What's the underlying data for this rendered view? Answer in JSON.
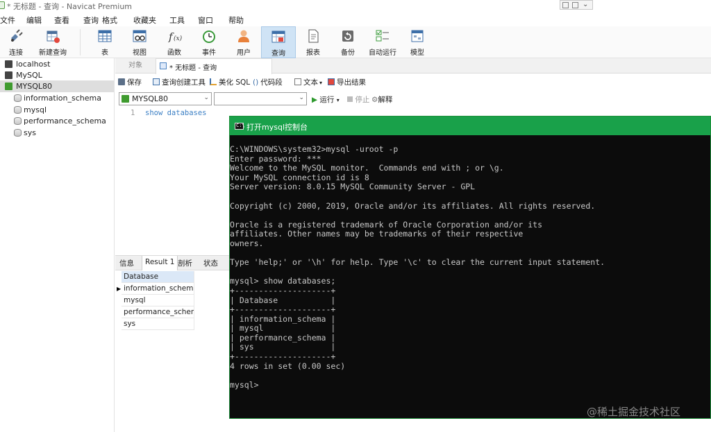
{
  "window": {
    "title": "* 无标题 - 查询 - Navicat Premium"
  },
  "menu": [
    "文件",
    "编辑",
    "查看",
    "查询",
    "格式",
    "收藏夹",
    "工具",
    "窗口",
    "帮助"
  ],
  "toolbar": {
    "buttons": [
      {
        "label": "连接",
        "icon": "plug-icon"
      },
      {
        "label": "新建查询",
        "icon": "new-query-icon"
      },
      {
        "label": "表",
        "icon": "table-icon"
      },
      {
        "label": "视图",
        "icon": "view-icon"
      },
      {
        "label": "函数",
        "icon": "function-icon"
      },
      {
        "label": "事件",
        "icon": "event-clock-icon"
      },
      {
        "label": "用户",
        "icon": "user-icon"
      },
      {
        "label": "查询",
        "icon": "query-icon",
        "active": true
      },
      {
        "label": "报表",
        "icon": "report-icon"
      },
      {
        "label": "备份",
        "icon": "backup-icon"
      },
      {
        "label": "自动运行",
        "icon": "auto-run-icon"
      },
      {
        "label": "模型",
        "icon": "model-icon"
      }
    ]
  },
  "tree": {
    "items": [
      {
        "label": "localhost"
      },
      {
        "label": "MySQL"
      },
      {
        "label": "MYSQL80",
        "selected": true
      },
      {
        "label": "information_schema"
      },
      {
        "label": "mysql"
      },
      {
        "label": "performance_schema"
      },
      {
        "label": "sys"
      }
    ]
  },
  "tabs": {
    "objects": "对象",
    "query": "* 无标题 - 查询"
  },
  "query_tools": {
    "save": "保存",
    "builder": "查询创建工具",
    "beautify": "美化 SQL",
    "snippet": "代码段",
    "text": "文本",
    "export": "导出结果"
  },
  "selectors": {
    "connection": "MYSQL80",
    "database": "",
    "run": "运行",
    "stop": "停止",
    "explain": "解释"
  },
  "editor": {
    "line_number": "1",
    "code": "show databases"
  },
  "result": {
    "tabs": [
      "信息",
      "Result 1",
      "剖析",
      "状态"
    ],
    "active_tab": "Result 1",
    "column": "Database",
    "rows": [
      "information_schema",
      "mysql",
      "performance_schem",
      "sys"
    ]
  },
  "console": {
    "title": "打开mysql控制台",
    "icon_text": "C:\\",
    "text": "C:\\WINDOWS\\system32>mysql -uroot -p\nEnter password: ***\nWelcome to the MySQL monitor.  Commands end with ; or \\g.\nYour MySQL connection id is 8\nServer version: 8.0.15 MySQL Community Server - GPL\n\nCopyright (c) 2000, 2019, Oracle and/or its affiliates. All rights reserved.\n\nOracle is a registered trademark of Oracle Corporation and/or its\naffiliates. Other names may be trademarks of their respective\nowners.\n\nType 'help;' or '\\h' for help. Type '\\c' to clear the current input statement.\n\nmysql> show databases;\n+--------------------+\n| Database           |\n+--------------------+\n| information_schema |\n| mysql              |\n| performance_schema |\n| sys                |\n+--------------------+\n4 rows in set (0.00 sec)\n\nmysql>"
  },
  "watermark": "@稀土掘金技术社区",
  "colors": {
    "console_title": "#19a14a",
    "active_button": "#cfe3f5",
    "sql_keyword": "#3b7fc4"
  }
}
